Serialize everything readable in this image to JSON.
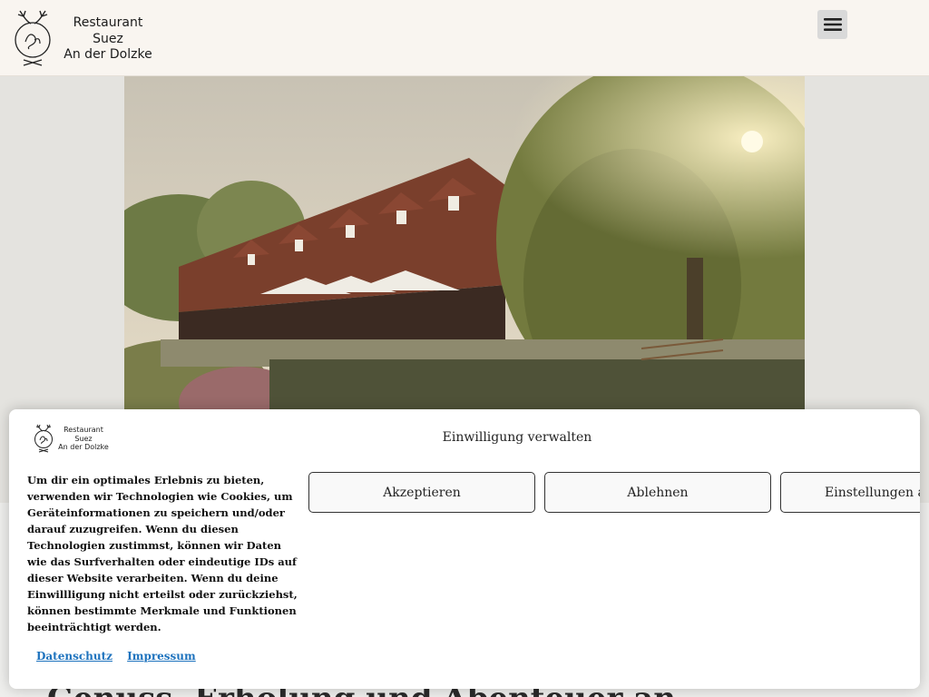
{
  "header": {
    "brand_line1": "Restaurant",
    "brand_line2": "Suez",
    "brand_line3": "An der Dolzke",
    "menu_icon": "hamburger-icon"
  },
  "hero": {
    "image_desc": "photo"
  },
  "page": {
    "heading": "Genuss, Erholung und Abenteuer an"
  },
  "cookie_banner": {
    "title": "Einwilligung verwalten",
    "brand_line1": "Restaurant",
    "brand_line2": "Suez",
    "brand_line3": "An der Dolzke",
    "text": "Um dir ein optimales Erlebnis zu bieten, verwenden wir Technologien wie Cookies, um Geräteinformationen zu speichern und/oder darauf zuzugreifen. Wenn du diesen Technologien zustimmst, können wir Daten wie das Surfverhalten oder eindeutige IDs auf dieser Website verarbeiten. Wenn du deine Einwillligung nicht erteilst oder zurückziehst, können bestimmte Merkmale und Funktionen beeinträchtigt werden.",
    "accept_label": "Akzeptieren",
    "deny_label": "Ablehnen",
    "prefs_label": "Einstellungen ansehen",
    "link_privacy": "Datenschutz",
    "link_imprint": "Impressum"
  },
  "colors": {
    "header_bg": "#f9f5f0",
    "link": "#1e73be",
    "menu_bg": "#d9d9d9"
  }
}
